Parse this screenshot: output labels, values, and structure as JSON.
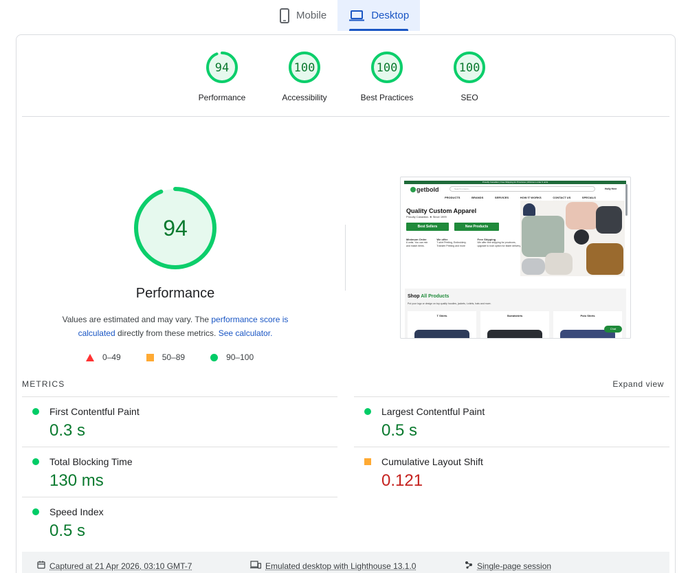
{
  "tabs": [
    {
      "label": "Mobile",
      "icon": "smartphone-icon",
      "active": false
    },
    {
      "label": "Desktop",
      "icon": "laptop-icon",
      "active": true
    }
  ],
  "colors": {
    "pass": "#0cce6b",
    "average": "#ffaa33",
    "fail": "#ff3333",
    "accent": "#1a56c4"
  },
  "scores": [
    {
      "label": "Performance",
      "score": 94
    },
    {
      "label": "Accessibility",
      "score": 100
    },
    {
      "label": "Best Practices",
      "score": 100
    },
    {
      "label": "SEO",
      "score": 100
    }
  ],
  "performance": {
    "score": 94,
    "title": "Performance",
    "desc_part1": "Values are estimated and may vary. The ",
    "desc_link1": "performance score is calculated",
    "desc_part2": " directly from these metrics. ",
    "desc_link2": "See calculator."
  },
  "legend": [
    {
      "range": "0–49",
      "icon": "triangle-icon"
    },
    {
      "range": "50–89",
      "icon": "square-icon"
    },
    {
      "range": "90–100",
      "icon": "circle-icon"
    }
  ],
  "screenshot": {
    "topbar": "Proudly Canadian | Free Shipping for Provinces | Minimum order 6 units",
    "logo": "getbold",
    "search_placeholder": "Search in items...",
    "account": "Holly Here",
    "nav": [
      "PRODUCTS",
      "BRANDS",
      "SERVICES",
      "HOW IT WORKS",
      "CONTACT US",
      "SPECIALS"
    ],
    "hero_title": "Quality Custom Apparel",
    "hero_sub": "Proudly Canadian. ★ Since 1999",
    "btn1": "Best Sellers",
    "btn2": "New Products",
    "info": [
      {
        "head": "Minimum Order",
        "body": "6 units. You can mix and match items."
      },
      {
        "head": "We offer",
        "body": "T-shirt Printing, Embroidery, Transfer Printing and more"
      },
      {
        "head": "Free Shipping",
        "body": "We offer free shipping for provinces, upgrade to rush option for faster delivery."
      }
    ],
    "shop_prefix": "Shop ",
    "shop_highlight": "All Products",
    "shop_sub": "Put your logo or design on top quality hoodies, jackets, t-shirts, hats and more.",
    "products": [
      "T Shirts",
      "Sweatshirts",
      "Polo Shirts"
    ],
    "chat": "Chat"
  },
  "metrics_label": "METRICS",
  "expand_label": "Expand view",
  "metrics": [
    {
      "name": "First Contentful Paint",
      "value": "0.3 s",
      "rating": "pass"
    },
    {
      "name": "Largest Contentful Paint",
      "value": "0.5 s",
      "rating": "pass"
    },
    {
      "name": "Total Blocking Time",
      "value": "130 ms",
      "rating": "pass"
    },
    {
      "name": "Cumulative Layout Shift",
      "value": "0.121",
      "rating": "average"
    },
    {
      "name": "Speed Index",
      "value": "0.5 s",
      "rating": "pass"
    }
  ],
  "footer": [
    {
      "text": "Captured at 21 Apr 2026, 03:10 GMT-7",
      "icon": "calendar-icon"
    },
    {
      "text": "Emulated desktop with Lighthouse 13.1.0",
      "icon": "devices-icon"
    },
    {
      "text": "Single-page session",
      "icon": "nodes-icon"
    }
  ]
}
